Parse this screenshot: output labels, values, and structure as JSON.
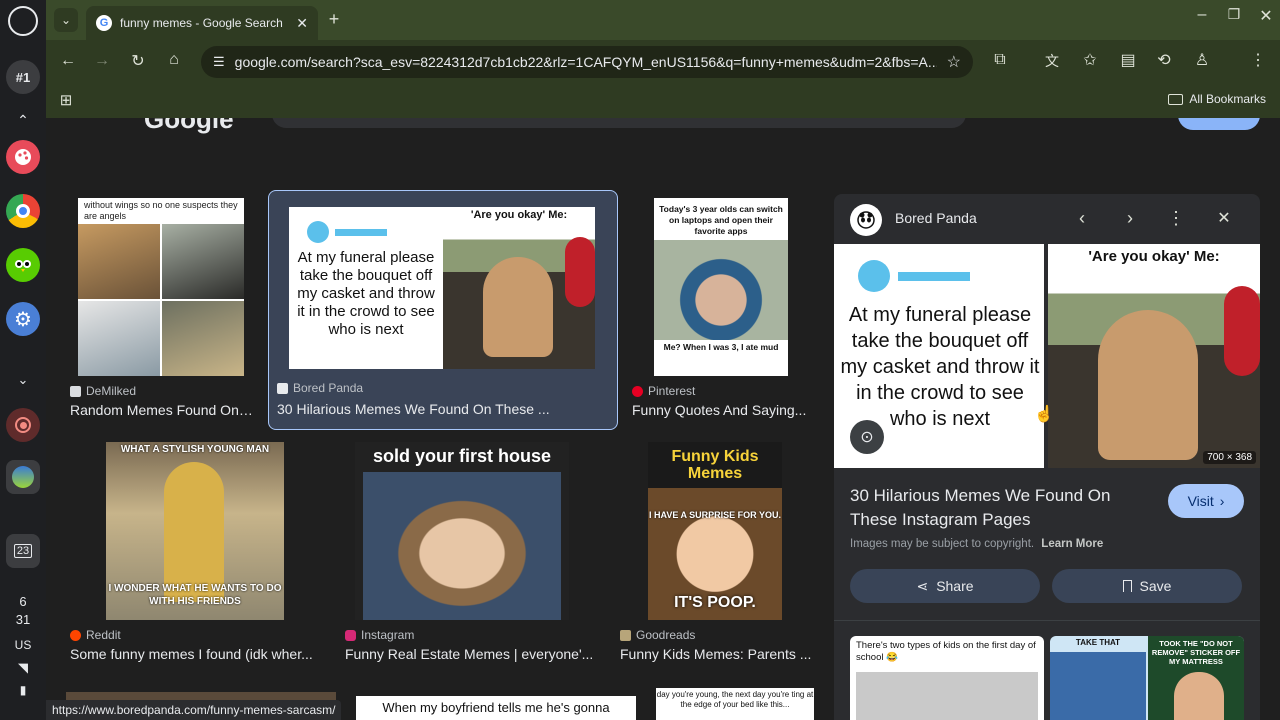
{
  "shelf": {
    "desk_label": "#1",
    "date_day": "6",
    "date_num": "31",
    "input_lang": "US"
  },
  "browser": {
    "tab_title": "funny memes - Google Search",
    "url": "google.com/search?sca_esv=8224312d7cb1cb22&rlz=1CAFQYM_enUS1156&q=funny+memes&udm=2&fbs=A...",
    "bookmarks_label": "All Bookmarks"
  },
  "results": [
    {
      "source": "DeMilked",
      "title": "Random Memes Found On ...",
      "caption": "without wings so no one suspects they are angels",
      "fav_color": "#dadce0"
    },
    {
      "source": "Bored Panda",
      "title": "30 Hilarious Memes We Found On These ...",
      "caption_left": "At my funeral please take the bouquet off my casket and throw it in the crowd to see who is next",
      "caption_right": "'Are you okay' Me:",
      "fav_color": "#e8eaed"
    },
    {
      "source": "Pinterest",
      "title": "Funny Quotes And Saying...",
      "caption_top": "Today's 3 year olds can switch on laptops and open their favorite apps",
      "caption_bottom": "Me? When I was 3, I ate mud",
      "fav_color": "#e60023"
    },
    {
      "source": "Reddit",
      "title": "Some funny memes I found (idk wher...",
      "caption_top": "WHAT A STYLISH YOUNG MAN",
      "caption_bottom": "I WONDER WHAT HE WANTS TO DO WITH HIS FRIENDS",
      "fav_color": "#ff4500"
    },
    {
      "source": "Instagram",
      "title": "Funny Real Estate Memes | everyone'...",
      "caption_top": "sold your first house",
      "fav_color": "#d62976"
    },
    {
      "source": "Goodreads",
      "title": "Funny Kids Memes: Parents ...",
      "caption_top": "Funny Kids Memes",
      "caption_mid": "I HAVE A SURPRISE FOR YOU.",
      "caption_bottom": "IT'S POOP.",
      "fav_color": "#b7a57a"
    }
  ],
  "bottom_row": {
    "mid_caption": "When my boyfriend tells me he's gonna",
    "right_caption": "day you're young, the next day you're ting at the edge of your bed like this..."
  },
  "panel": {
    "source": "Bored Panda",
    "dimensions": "700 × 368",
    "image_left_text": "At my funeral please take the bouquet off my casket and throw it in the crowd to see who is next",
    "image_right_text": "'Are you okay' Me:",
    "title": "30 Hilarious Memes We Found On These Instagram Pages",
    "visit_label": "Visit",
    "copyright": "Images may be subject to copyright.",
    "learn_more": "Learn More",
    "share_label": "Share",
    "save_label": "Save",
    "related_left": "There's two types of kids on the first day of school 😂",
    "related_right_a": "TAKE THAT",
    "related_right_b": "TOOK THE \"DO NOT REMOVE\" STICKER OFF MY MATTRESS"
  },
  "status_url": "https://www.boredpanda.com/funny-memes-sarcasm/"
}
